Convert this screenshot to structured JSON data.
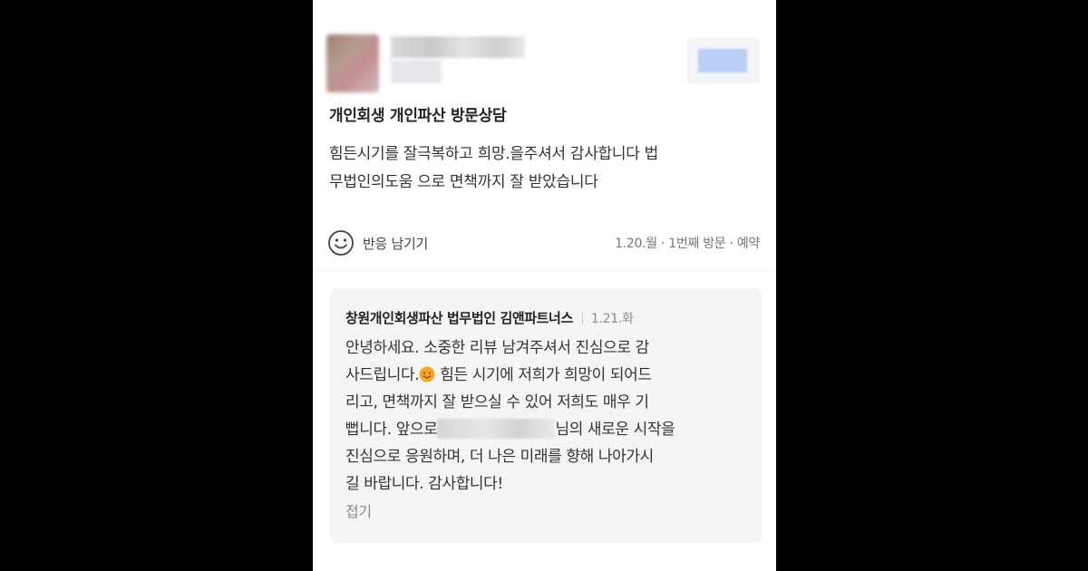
{
  "review": {
    "title": "개인회생 개인파산 방문상담",
    "body_line1": "힘든시기를 잘극복하고 희망.을주셔서 감사합니다 법",
    "body_line2": "무법인의도움 으로 면책까지 잘 받았습니다",
    "react_label": "반응 남기기",
    "visit_meta": "1.20.월 · 1번째 방문 · 예약"
  },
  "reply": {
    "owner_name": "창원개인회생파산 법무법인 김앤파트너스",
    "date": "1.21.화",
    "line1": "안녕하세요. 소중한 리뷰 남겨주셔서 진심으로 감",
    "line2_before_emoji": "사드립니다.",
    "line2_after_emoji": " 힘든 시기에 저희가 희망이 되어드",
    "line3": "리고, 면책까지 잘 받으실 수 있어 저희도 매우 기",
    "line4_before_blur": "뻡니다. 앞으로",
    "line4_after_blur": "님의 새로운 시작을",
    "line5": "진심으로 응원하며, 더 나은 미래를 향해 나아가시",
    "line6": "길 바랍니다. 감사합니다!",
    "fold_label": "접기"
  },
  "icons": {
    "reaction": "smile-face-icon",
    "emoji": "smiling-face-emoji"
  },
  "colors": {
    "background": "#000000",
    "card": "#ffffff",
    "reply_background": "#f5f5f7",
    "emoji": "#f5a623"
  }
}
